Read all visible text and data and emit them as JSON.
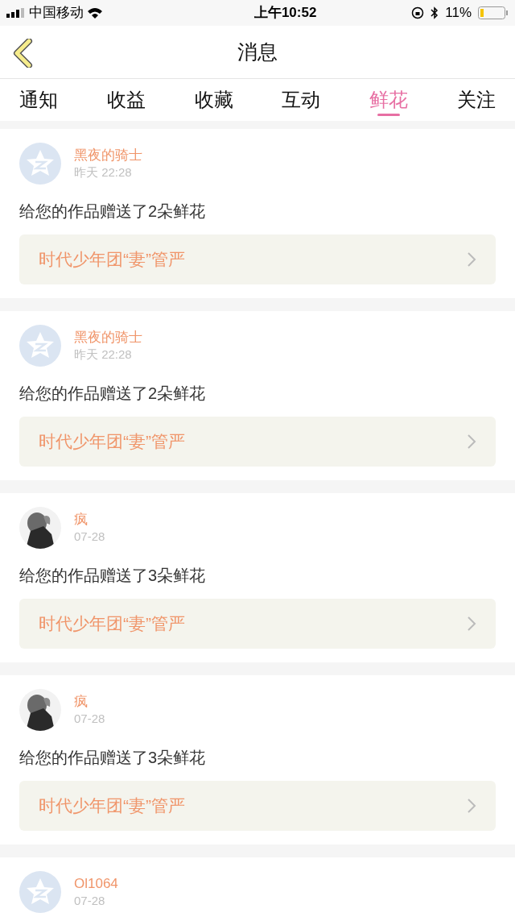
{
  "status_bar": {
    "carrier": "中国移动",
    "time": "上午10:52",
    "battery": "11%"
  },
  "header": {
    "title": "消息"
  },
  "tabs": [
    {
      "label": "通知",
      "selected": false
    },
    {
      "label": "收益",
      "selected": false
    },
    {
      "label": "收藏",
      "selected": false
    },
    {
      "label": "互动",
      "selected": false
    },
    {
      "label": "鲜花",
      "selected": true
    },
    {
      "label": "关注",
      "selected": false
    }
  ],
  "messages": [
    {
      "avatar": {
        "kind": "default"
      },
      "name": "黑夜的骑士",
      "time": "昨天 22:28",
      "text": "给您的作品赠送了2朵鲜花",
      "work": "时代少年团“妻”管严"
    },
    {
      "avatar": {
        "kind": "default"
      },
      "name": "黑夜的骑士",
      "time": "昨天 22:28",
      "text": "给您的作品赠送了2朵鲜花",
      "work": "时代少年团“妻”管严"
    },
    {
      "name": "疯",
      "time": "07-28",
      "text": "给您的作品赠送了3朵鲜花",
      "work": "时代少年团“妻”管严"
    },
    {
      "name": "疯",
      "time": "07-28",
      "text": "给您的作品赠送了3朵鲜花",
      "work": "时代少年团“妻”管严"
    },
    {
      "avatar": {
        "kind": "default"
      },
      "name": "Ol1064",
      "time": "07-28"
    }
  ]
}
